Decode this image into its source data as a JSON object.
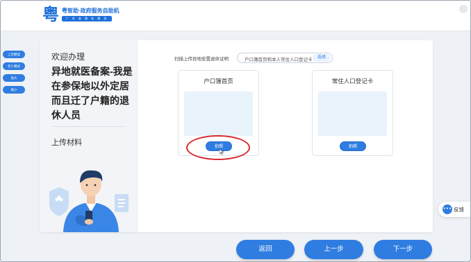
{
  "header": {
    "logo_glyph": "粤",
    "logo_title": "粤智助·政府服务自助机",
    "logo_subtitle": "广 东 省 政 务 服 务"
  },
  "side_tabs": [
    {
      "label": "上页朗读"
    },
    {
      "label": "老人模式"
    },
    {
      "label": "放大"
    },
    {
      "label": "缩小"
    }
  ],
  "left_panel": {
    "welcome": "欢迎办理",
    "case_title": "异地就医备案-我是在参保地以外定居而且迁了户籍的退休人员",
    "section_label": "上传材料"
  },
  "scan_row": {
    "label": "扫描上传异地安置退休证明",
    "input_value": "户口簿首页和本人常住人口登记卡",
    "choose_label": "选择"
  },
  "documents": [
    {
      "title": "户口簿首页",
      "button_label": "拍照"
    },
    {
      "title": "常住人口登记卡",
      "button_label": "拍照"
    }
  ],
  "feedback": {
    "icon": "chat-icon",
    "label": "反馈"
  },
  "footer": {
    "back_label": "返回",
    "prev_label": "上一步",
    "next_label": "下一步"
  },
  "colors": {
    "primary": "#2f7de1",
    "highlight": "#d9262f",
    "preview": "#e8f3fc"
  }
}
